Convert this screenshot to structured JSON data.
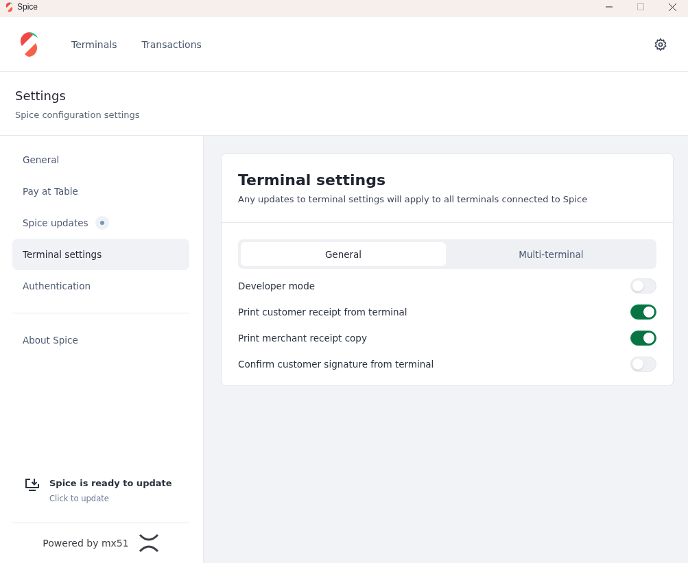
{
  "window": {
    "title": "Spice"
  },
  "nav": [
    {
      "label": "Terminals",
      "selected": false
    },
    {
      "label": "Transactions",
      "selected": false
    }
  ],
  "page": {
    "title": "Settings",
    "subtitle": "Spice configuration settings"
  },
  "sidebar": {
    "items": [
      {
        "label": "General",
        "selected": false,
        "dot": false
      },
      {
        "label": "Pay at Table",
        "selected": false,
        "dot": false
      },
      {
        "label": "Spice updates",
        "selected": false,
        "dot": true
      },
      {
        "label": "Terminal settings",
        "selected": true,
        "dot": false
      },
      {
        "label": "Authentication",
        "selected": false,
        "dot": false
      }
    ],
    "secondary_items": [
      {
        "label": "About Spice",
        "selected": false,
        "dot": false
      }
    ],
    "update_notice": {
      "title": "Spice is ready to update",
      "action": "Click to update"
    },
    "footer": "Powered by mx51"
  },
  "card": {
    "title": "Terminal settings",
    "description": "Any updates to terminal settings will apply to all terminals connected to Spice",
    "tabs": [
      {
        "label": "General",
        "selected": true
      },
      {
        "label": "Multi-terminal",
        "selected": false
      }
    ],
    "settings": [
      {
        "label": "Developer mode",
        "on": false
      },
      {
        "label": "Print customer receipt from terminal",
        "on": true
      },
      {
        "label": "Print merchant receipt copy",
        "on": true
      },
      {
        "label": "Confirm customer signature from terminal",
        "on": false
      }
    ]
  }
}
